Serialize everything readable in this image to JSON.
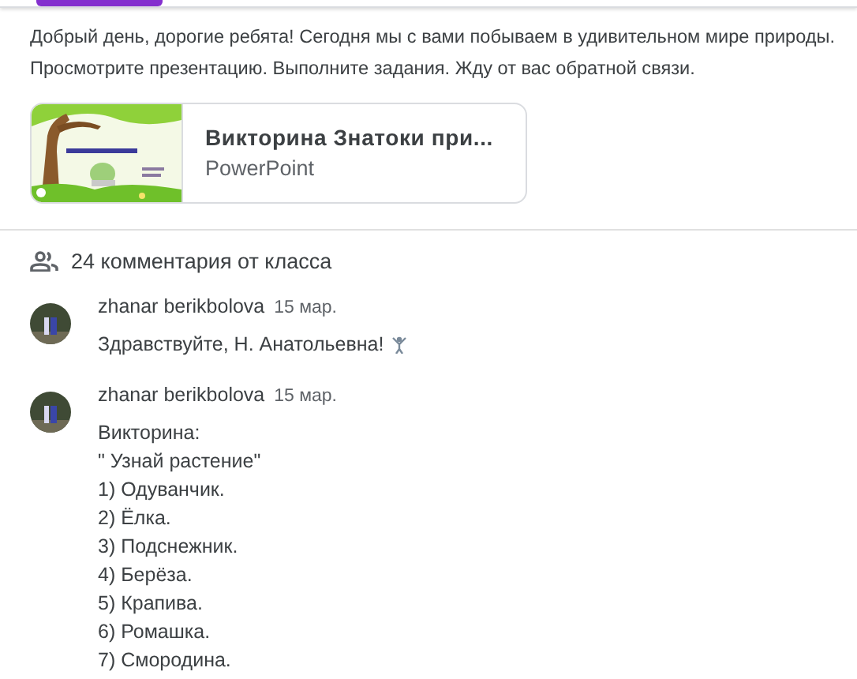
{
  "description": [
    "Добрый день, дорогие ребята! Сегодня мы с вами побываем в удивительном мире природы.",
    "Просмотрите презентацию. Выполните задания. Жду от вас обратной связи."
  ],
  "attachment": {
    "kind": "picture",
    "title": "Викторина Знатоки при...",
    "type": "PowerPoint"
  },
  "comments_header": "24 комментария от класса",
  "comments": [
    {
      "author": "zhanar berikbolova",
      "date": "15 мар.",
      "lines": [
        "Здравствуйте, Н. Анатольевна!"
      ],
      "emoji": true
    },
    {
      "author": "zhanar berikbolova",
      "date": "15 мар.",
      "lines": [
        "Викторина:",
        "\" Узнай растение\"",
        "1) Одуванчик.",
        "2) Ёлка.",
        "3) Подснежник.",
        "4) Берёза.",
        "5) Крапива.",
        "6) Ромашка.",
        "7) Смородина."
      ],
      "emoji": false
    }
  ]
}
